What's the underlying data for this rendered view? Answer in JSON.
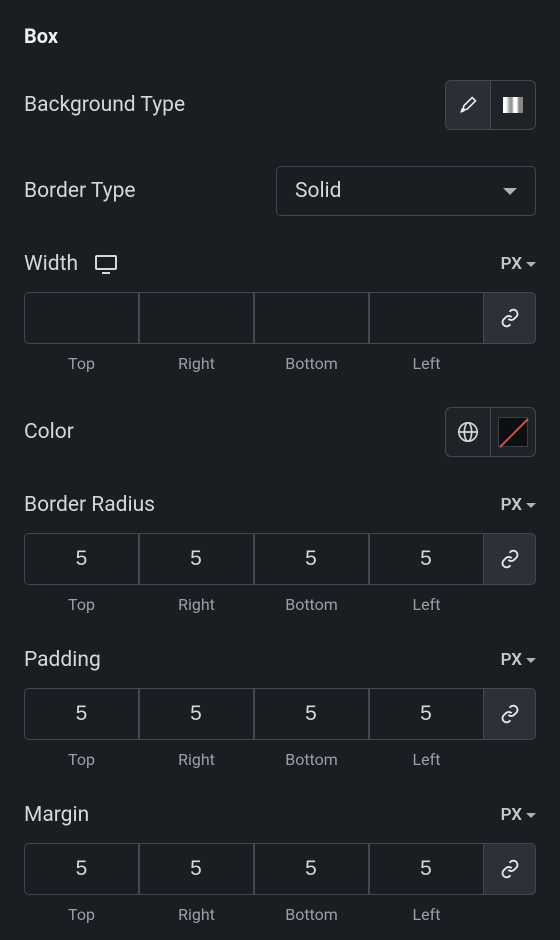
{
  "section": {
    "title": "Box"
  },
  "backgroundType": {
    "label": "Background Type"
  },
  "borderType": {
    "label": "Border Type",
    "value": "Solid"
  },
  "width": {
    "label": "Width",
    "unit": "PX",
    "values": {
      "top": "",
      "right": "",
      "bottom": "",
      "left": ""
    },
    "sideLabels": {
      "top": "Top",
      "right": "Right",
      "bottom": "Bottom",
      "left": "Left"
    }
  },
  "color": {
    "label": "Color"
  },
  "borderRadius": {
    "label": "Border Radius",
    "unit": "PX",
    "values": {
      "top": "5",
      "right": "5",
      "bottom": "5",
      "left": "5"
    },
    "sideLabels": {
      "top": "Top",
      "right": "Right",
      "bottom": "Bottom",
      "left": "Left"
    }
  },
  "padding": {
    "label": "Padding",
    "unit": "PX",
    "values": {
      "top": "5",
      "right": "5",
      "bottom": "5",
      "left": "5"
    },
    "sideLabels": {
      "top": "Top",
      "right": "Right",
      "bottom": "Bottom",
      "left": "Left"
    }
  },
  "margin": {
    "label": "Margin",
    "unit": "PX",
    "values": {
      "top": "5",
      "right": "5",
      "bottom": "5",
      "left": "5"
    },
    "sideLabels": {
      "top": "Top",
      "right": "Right",
      "bottom": "Bottom",
      "left": "Left"
    }
  }
}
